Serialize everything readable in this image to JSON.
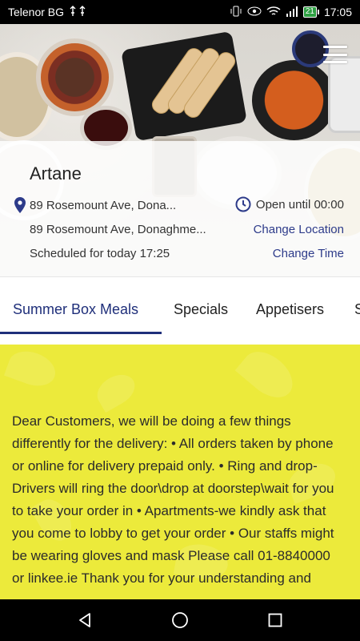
{
  "status_bar": {
    "carrier": "Telenor BG",
    "usb_icons": "⚹ ⚹",
    "battery": "21",
    "time": "17:05"
  },
  "store": {
    "name": "Artane",
    "address_short": "89 Rosemount Ave, Dona...",
    "address_full": "89 Rosemount Ave, Donaghme...",
    "hours": "Open until 00:00",
    "schedule": "Scheduled for today 17:25",
    "change_location": "Change Location",
    "change_time": "Change Time"
  },
  "tabs": [
    {
      "label": "Summer Box Meals",
      "active": true
    },
    {
      "label": "Specials"
    },
    {
      "label": "Appetisers"
    },
    {
      "label": "S"
    }
  ],
  "notice": {
    "text": "Dear Customers, we will be doing a few things differently for the delivery: • All orders taken by phone or online for delivery prepaid only. • Ring and drop-Drivers will ring the door\\drop at doorstep\\wait for you to take your order in • Apartments-we kindly ask that you come to lobby to get your order • Our staffs might be wearing gloves and mask Please call 01-8840000 or linkee.ie Thank you for your understanding and"
  },
  "colors": {
    "accent": "#1f2f7a",
    "notice_bg": "#ecea3b"
  }
}
